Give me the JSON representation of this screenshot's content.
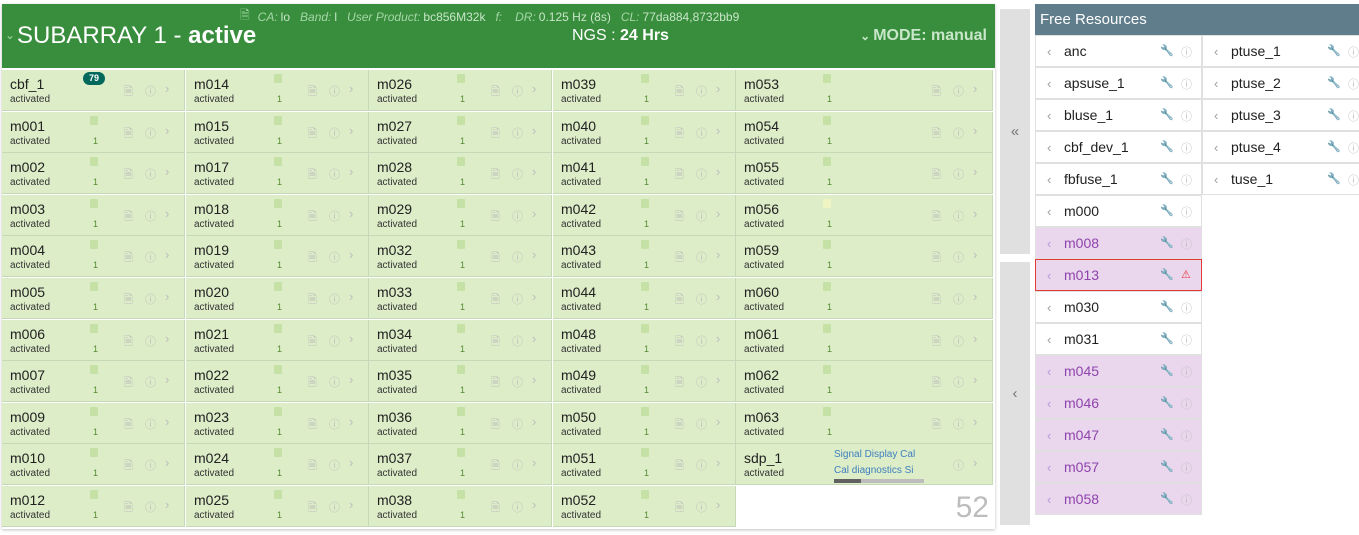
{
  "subarray": {
    "title": "SUBARRAY 1 - ",
    "state": "active",
    "meta": {
      "ca_label": "CA:",
      "ca_value": "lo",
      "band_label": "Band:",
      "band_value": "l",
      "product_label": "User Product:",
      "product_value": "bc856M32k",
      "f_label": "f:",
      "f_value": "",
      "dr_label": "DR:",
      "dr_value": "0.125 Hz (8s)",
      "cl_label": "CL:",
      "cl_value": "77da884,8732bb9"
    },
    "ngs_label": "NGS :",
    "ngs_value": "24 Hrs",
    "mode_label": "MODE:",
    "mode_value": "manual",
    "resource_count": "52"
  },
  "columns": [
    [
      {
        "name": "cbf_1",
        "state": "activated",
        "badge": "79"
      },
      {
        "name": "m001",
        "state": "activated",
        "count": "1"
      },
      {
        "name": "m002",
        "state": "activated",
        "count": "1"
      },
      {
        "name": "m003",
        "state": "activated",
        "count": "1"
      },
      {
        "name": "m004",
        "state": "activated",
        "count": "1"
      },
      {
        "name": "m005",
        "state": "activated",
        "count": "1"
      },
      {
        "name": "m006",
        "state": "activated",
        "count": "1"
      },
      {
        "name": "m007",
        "state": "activated",
        "count": "1"
      },
      {
        "name": "m009",
        "state": "activated",
        "count": "1"
      },
      {
        "name": "m010",
        "state": "activated",
        "count": "1"
      },
      {
        "name": "m012",
        "state": "activated",
        "count": "1"
      }
    ],
    [
      {
        "name": "m014",
        "state": "activated",
        "count": "1"
      },
      {
        "name": "m015",
        "state": "activated",
        "count": "1"
      },
      {
        "name": "m017",
        "state": "activated",
        "count": "1"
      },
      {
        "name": "m018",
        "state": "activated",
        "count": "1"
      },
      {
        "name": "m019",
        "state": "activated",
        "count": "1"
      },
      {
        "name": "m020",
        "state": "activated",
        "count": "1"
      },
      {
        "name": "m021",
        "state": "activated",
        "count": "1"
      },
      {
        "name": "m022",
        "state": "activated",
        "count": "1"
      },
      {
        "name": "m023",
        "state": "activated",
        "count": "1"
      },
      {
        "name": "m024",
        "state": "activated",
        "count": "1"
      },
      {
        "name": "m025",
        "state": "activated",
        "count": "1"
      }
    ],
    [
      {
        "name": "m026",
        "state": "activated",
        "count": "1"
      },
      {
        "name": "m027",
        "state": "activated",
        "count": "1"
      },
      {
        "name": "m028",
        "state": "activated",
        "count": "1"
      },
      {
        "name": "m029",
        "state": "activated",
        "count": "1"
      },
      {
        "name": "m032",
        "state": "activated",
        "count": "1"
      },
      {
        "name": "m033",
        "state": "activated",
        "count": "1"
      },
      {
        "name": "m034",
        "state": "activated",
        "count": "1"
      },
      {
        "name": "m035",
        "state": "activated",
        "count": "1"
      },
      {
        "name": "m036",
        "state": "activated",
        "count": "1"
      },
      {
        "name": "m037",
        "state": "activated",
        "count": "1"
      },
      {
        "name": "m038",
        "state": "activated",
        "count": "1"
      }
    ],
    [
      {
        "name": "m039",
        "state": "activated",
        "count": "1"
      },
      {
        "name": "m040",
        "state": "activated",
        "count": "1"
      },
      {
        "name": "m041",
        "state": "activated",
        "count": "1"
      },
      {
        "name": "m042",
        "state": "activated",
        "count": "1"
      },
      {
        "name": "m043",
        "state": "activated",
        "count": "1"
      },
      {
        "name": "m044",
        "state": "activated",
        "count": "1"
      },
      {
        "name": "m048",
        "state": "activated",
        "count": "1"
      },
      {
        "name": "m049",
        "state": "activated",
        "count": "1"
      },
      {
        "name": "m050",
        "state": "activated",
        "count": "1"
      },
      {
        "name": "m051",
        "state": "activated",
        "count": "1"
      },
      {
        "name": "m052",
        "state": "activated",
        "count": "1"
      }
    ],
    [
      {
        "name": "m053",
        "state": "activated",
        "count": "1"
      },
      {
        "name": "m054",
        "state": "activated",
        "count": "1"
      },
      {
        "name": "m055",
        "state": "activated",
        "count": "1"
      },
      {
        "name": "m056",
        "state": "activated",
        "count": "1",
        "warn": true
      },
      {
        "name": "m059",
        "state": "activated",
        "count": "1"
      },
      {
        "name": "m060",
        "state": "activated",
        "count": "1"
      },
      {
        "name": "m061",
        "state": "activated",
        "count": "1"
      },
      {
        "name": "m062",
        "state": "activated",
        "count": "1"
      },
      {
        "name": "m063",
        "state": "activated",
        "count": "1"
      },
      {
        "name": "sdp_1",
        "state": "activated",
        "sdp": true
      }
    ]
  ],
  "sdp_links": [
    "Signal Display",
    "Cal",
    "Cal diagnostics",
    "Si"
  ],
  "sdp_progress": 0.3,
  "free_resources": {
    "title": "Free Resources",
    "left": [
      {
        "name": "anc",
        "status": "normal"
      },
      {
        "name": "apsuse_1",
        "status": "normal"
      },
      {
        "name": "bluse_1",
        "status": "normal"
      },
      {
        "name": "cbf_dev_1",
        "status": "normal"
      },
      {
        "name": "fbfuse_1",
        "status": "normal"
      },
      {
        "name": "m000",
        "status": "normal"
      },
      {
        "name": "m008",
        "status": "maintenance"
      },
      {
        "name": "m013",
        "status": "error"
      },
      {
        "name": "m030",
        "status": "normal"
      },
      {
        "name": "m031",
        "status": "normal"
      },
      {
        "name": "m045",
        "status": "maintenance"
      },
      {
        "name": "m046",
        "status": "maintenance"
      },
      {
        "name": "m047",
        "status": "maintenance"
      },
      {
        "name": "m057",
        "status": "maintenance"
      },
      {
        "name": "m058",
        "status": "maintenance"
      }
    ],
    "right": [
      {
        "name": "ptuse_1",
        "status": "normal"
      },
      {
        "name": "ptuse_2",
        "status": "normal"
      },
      {
        "name": "ptuse_3",
        "status": "normal"
      },
      {
        "name": "ptuse_4",
        "status": "normal"
      },
      {
        "name": "tuse_1",
        "status": "normal"
      }
    ]
  },
  "icons": {
    "doc": "document-icon",
    "info": "info-icon",
    "chevron": "chevron-right-icon",
    "wrench": "wrench-icon",
    "warning": "warning-icon"
  },
  "colors": {
    "header": "#388e3c",
    "cell": "#dcedc8",
    "free_header": "#607d8b",
    "maintenance": "#ead7ee",
    "error": "#e53935",
    "badge": "#00695c"
  }
}
